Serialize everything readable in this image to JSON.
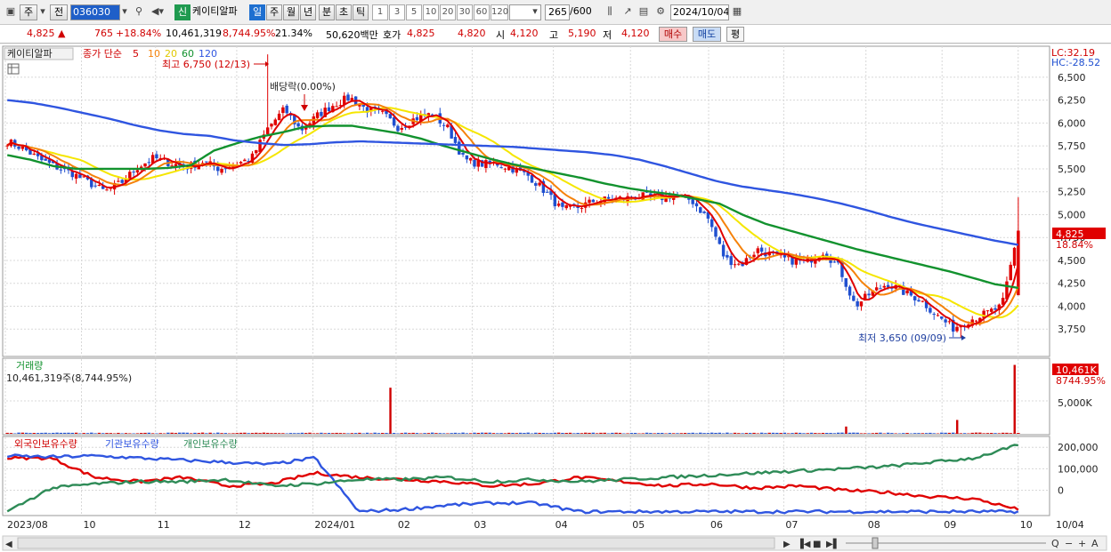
{
  "toolbar": {
    "market_type": "주",
    "view_mode": "전",
    "stock_code": "036030",
    "new_badge": "신",
    "stock_name": "케이티알파",
    "periods": [
      "일",
      "주",
      "월",
      "년",
      "분",
      "초",
      "틱"
    ],
    "active_period": "일",
    "tick_options": [
      "1",
      "3",
      "5",
      "10",
      "20",
      "30",
      "60",
      "120"
    ],
    "count_value": "265",
    "count_max": "/600",
    "date": "2024/10/04"
  },
  "quote": {
    "price": "4,825 ▲",
    "change": "765",
    "change_rate": "+18.84%",
    "volume": "10,461,319",
    "volume_rate": "8,744.95%",
    "turnover": "21.34%",
    "amount": "50,620백만",
    "bid_ask_label": "호가",
    "ask": "4,825",
    "bid": "4,820",
    "open_label": "시",
    "open": "4,120",
    "high_label": "고",
    "high": "5,190",
    "low_label": "저",
    "low": "4,120",
    "buy_button": "매수",
    "sell_button": "매도",
    "eval_button": "평"
  },
  "colors": {
    "candle_up": "#e00000",
    "candle_down": "#1f4fd0",
    "ma5": "#e00000",
    "ma10": "#f5820a",
    "ma20": "#f5e600",
    "ma60": "#12922e",
    "ma120": "#2f55e0",
    "volume_bar": "#d00000",
    "foreign_line": "#e00000",
    "institution_line": "#2f55e0",
    "individual_line": "#2e8b57"
  },
  "chart_data": [
    {
      "type": "candlestick",
      "name": "케이티알파",
      "legend": {
        "label": "종가 단순",
        "periods": [
          "5",
          "10",
          "20",
          "60",
          "120"
        ]
      },
      "ylim": [
        3500,
        6800
      ],
      "y_ticks": [
        "6,500",
        "6,250",
        "6,000",
        "5,750",
        "5,500",
        "5,250",
        "5,000",
        "4,750",
        "4,500",
        "4,250",
        "4,000",
        "3,750"
      ],
      "x_labels": [
        "2023/08",
        "10",
        "11",
        "12",
        "2024/01",
        "02",
        "03",
        "04",
        "05",
        "06",
        "07",
        "08",
        "09",
        "10",
        "10/04"
      ],
      "lc": "LC:32.19",
      "hc": "HC:-28.52",
      "last_price": "4,825",
      "last_change": "18.84%",
      "annotations": {
        "high": "최고 6,750 (12/13)",
        "low": "최저 3,650 (09/09)",
        "dividend": "배당락(0.00%)"
      },
      "keypoints": {
        "close": [
          5800,
          5720,
          5600,
          5520,
          5450,
          5350,
          5250,
          5350,
          5520,
          5620,
          5560,
          5520,
          5580,
          5500,
          5550,
          5620,
          5950,
          6150,
          5920,
          6080,
          6200,
          6280,
          6150,
          6100,
          5950,
          6050,
          6100,
          5950,
          5600,
          5550,
          5560,
          5500,
          5420,
          5250,
          5050,
          5080,
          5150,
          5170,
          5180,
          5200,
          5180,
          5220,
          5150,
          4950,
          4520,
          4450,
          4620,
          4550,
          4500,
          4480,
          4600,
          4430,
          4000,
          4150,
          4250,
          4150,
          4070,
          3900,
          3760,
          3850,
          3920,
          4000,
          4825
        ],
        "ma60": [
          5650,
          5600,
          5530,
          5500,
          5500,
          5500,
          5500,
          5510,
          5540,
          5700,
          5780,
          5850,
          5900,
          5960,
          5970,
          5970,
          5930,
          5890,
          5830,
          5750,
          5680,
          5610,
          5550,
          5500,
          5450,
          5400,
          5340,
          5290,
          5250,
          5220,
          5170,
          5120,
          5000,
          4900,
          4830,
          4760,
          4690,
          4620,
          4560,
          4500,
          4440,
          4380,
          4310,
          4240,
          4200
        ],
        "ma120": [
          6250,
          6220,
          6170,
          6110,
          6050,
          5980,
          5920,
          5880,
          5860,
          5810,
          5780,
          5760,
          5770,
          5790,
          5800,
          5790,
          5780,
          5770,
          5760,
          5750,
          5740,
          5720,
          5700,
          5680,
          5650,
          5600,
          5530,
          5450,
          5370,
          5310,
          5270,
          5230,
          5180,
          5120,
          5050,
          4970,
          4900,
          4840,
          4780,
          4720,
          4670
        ]
      }
    },
    {
      "type": "bar",
      "name": "거래량",
      "title": "거래량",
      "info": "10,461,319주(8,744.95%)",
      "y_tick": "5,000K",
      "last_value_label": "10,461K",
      "last_rate_label": "8744.95%",
      "unit": "thousand shares",
      "ylim": [
        0,
        10800
      ],
      "spikes": [
        {
          "position": 0.38,
          "value": 7000
        },
        {
          "position": 0.83,
          "value": 1100
        },
        {
          "position": 0.94,
          "value": 2100
        },
        {
          "position": 0.998,
          "value": 10461
        }
      ]
    },
    {
      "type": "line",
      "title_items": [
        "외국인보유수량",
        "기관보유수량",
        "개인보유수량"
      ],
      "y_ticks": [
        "200,000",
        "100,000",
        "0"
      ],
      "ylim": [
        -110000,
        230000
      ],
      "series": [
        {
          "name": "외국인보유수량",
          "values": [
            150000,
            150000,
            60000,
            40000,
            60000,
            20000,
            30000,
            80000,
            60000,
            50000,
            40000,
            20000,
            30000,
            60000,
            40000,
            20000,
            30000,
            10000,
            20000,
            0,
            -10000,
            -30000,
            -40000,
            -90000
          ]
        },
        {
          "name": "기관보유수량",
          "values": [
            160000,
            155000,
            160000,
            150000,
            140000,
            130000,
            120000,
            150000,
            -100000,
            -90000,
            -70000,
            -60000,
            -60000,
            -100000,
            -100000,
            -100000,
            -100000,
            -100000,
            -100000,
            -100000,
            -100000,
            -100000,
            -100000,
            -100000
          ]
        },
        {
          "name": "개인보유수량",
          "values": [
            -100000,
            10000,
            30000,
            40000,
            40000,
            50000,
            20000,
            30000,
            50000,
            50000,
            60000,
            40000,
            50000,
            40000,
            50000,
            60000,
            70000,
            80000,
            90000,
            100000,
            110000,
            130000,
            150000,
            210000
          ]
        }
      ]
    }
  ]
}
